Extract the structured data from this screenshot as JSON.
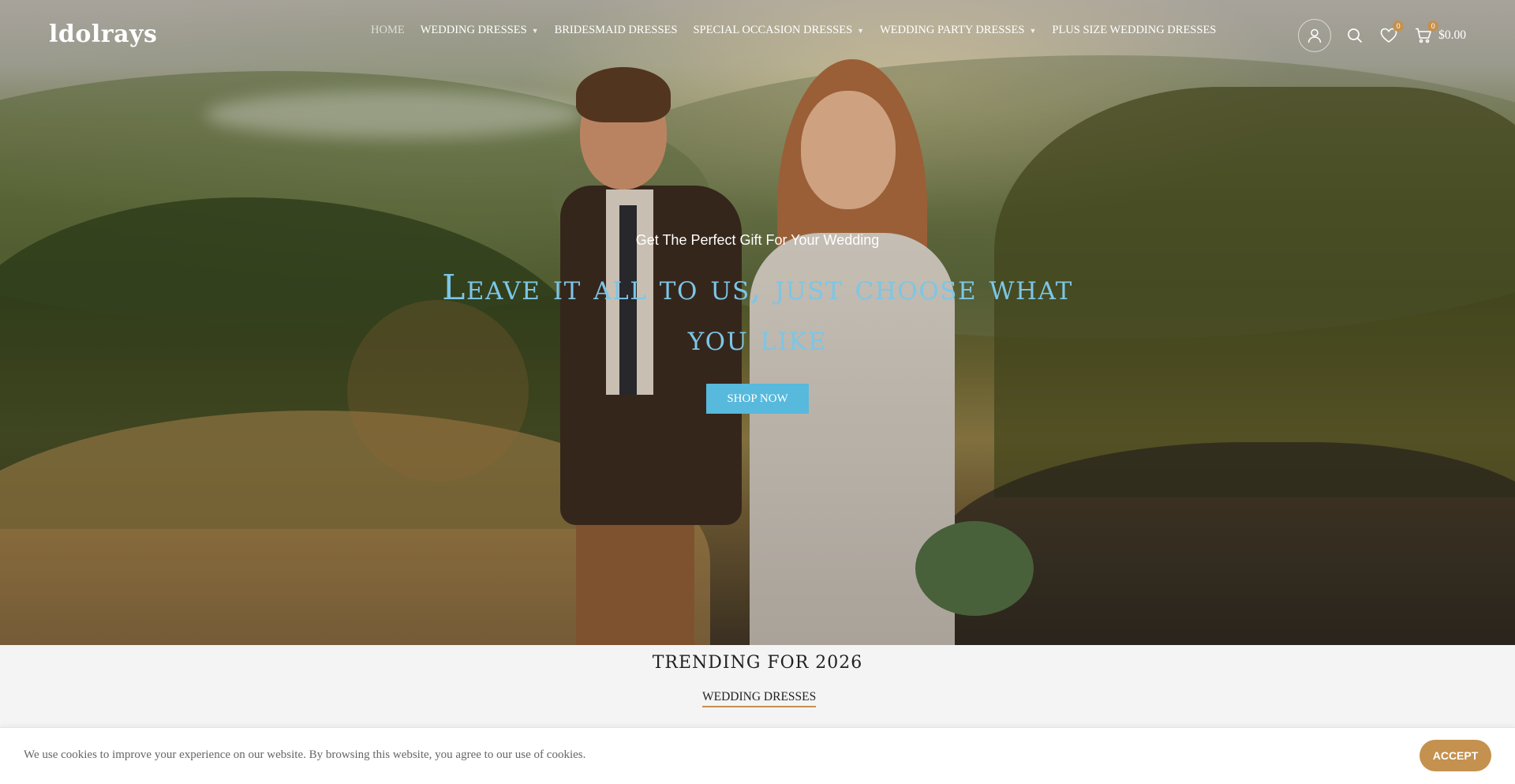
{
  "brand": {
    "logo_text": "ldolrays"
  },
  "nav": {
    "items": [
      {
        "label": "HOME",
        "dropdown": false,
        "active": true
      },
      {
        "label": "WEDDING DRESSES",
        "dropdown": true
      },
      {
        "label": "BRIDESMAID DRESSES",
        "dropdown": false
      },
      {
        "label": "SPECIAL OCCASION DRESSES",
        "dropdown": true
      },
      {
        "label": "WEDDING PARTY DRESSES",
        "dropdown": true
      },
      {
        "label": "PLUS SIZE WEDDING DRESSES",
        "dropdown": false
      }
    ]
  },
  "header_icons": {
    "account": "user-icon",
    "search": "search-icon",
    "wishlist": {
      "icon": "heart-icon",
      "count": "0"
    },
    "cart": {
      "icon": "cart-icon",
      "count": "0",
      "total": "$0.00"
    }
  },
  "hero": {
    "subtitle": "Get The Perfect Gift For Your Wedding",
    "title": "Leave it all to us, just choose what you like",
    "cta": "SHOP NOW"
  },
  "trending": {
    "title": "TRENDING FOR 2026",
    "tab": "WEDDING DRESSES"
  },
  "cookie": {
    "text": "We use cookies to improve your experience on our website. By browsing this website, you agree to our use of cookies.",
    "accept": "ACCEPT"
  },
  "colors": {
    "accent": "#c4914f",
    "hero_title": "#7cc6e6",
    "cta_bg": "#57b9dc"
  }
}
